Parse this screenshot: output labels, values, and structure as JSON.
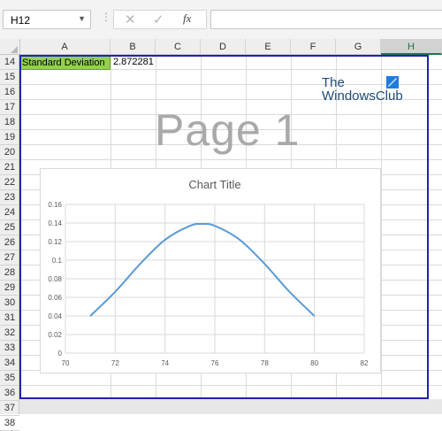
{
  "formula_bar": {
    "name_box_value": "H12",
    "dots": "⋮",
    "cancel_icon": "✕",
    "enter_icon": "✓",
    "fx_label": "fx",
    "formula_value": ""
  },
  "grid": {
    "columns": [
      "A",
      "B",
      "C",
      "D",
      "E",
      "F",
      "G",
      "H"
    ],
    "selected_column": "H",
    "rows": [
      "14",
      "15",
      "16",
      "17",
      "18",
      "19",
      "20",
      "21",
      "22",
      "23",
      "24",
      "25",
      "26",
      "27",
      "28",
      "29",
      "30",
      "31",
      "32",
      "33",
      "34",
      "35",
      "36",
      "37",
      "38"
    ],
    "cell_a14": "Standard Deviation",
    "cell_b14": "2.872281"
  },
  "watermark": "Page 1",
  "logo": {
    "line1": "The",
    "line2": "WindowsClub"
  },
  "colors": {
    "selected_cell_fill": "#92d050",
    "page_border": "#1f24a8",
    "series_line": "#5b9bd5"
  },
  "chart_data": {
    "type": "scatter",
    "title": "Chart Title",
    "xlabel": "",
    "ylabel": "",
    "xlim": [
      70,
      82
    ],
    "ylim": [
      0,
      0.16
    ],
    "x_ticks": [
      "70",
      "72",
      "74",
      "76",
      "78",
      "80",
      "82"
    ],
    "y_ticks": [
      "0",
      "0.02",
      "0.04",
      "0.06",
      "0.08",
      "0.1",
      "0.12",
      "0.14",
      "0.16"
    ],
    "grid": true,
    "legend": "none",
    "series": [
      {
        "x": [
          71,
          72,
          73,
          74,
          75,
          75.5,
          76,
          77,
          78,
          79,
          80
        ],
        "values": [
          0.04,
          0.066,
          0.096,
          0.122,
          0.137,
          0.139,
          0.137,
          0.122,
          0.096,
          0.066,
          0.04
        ]
      }
    ]
  }
}
